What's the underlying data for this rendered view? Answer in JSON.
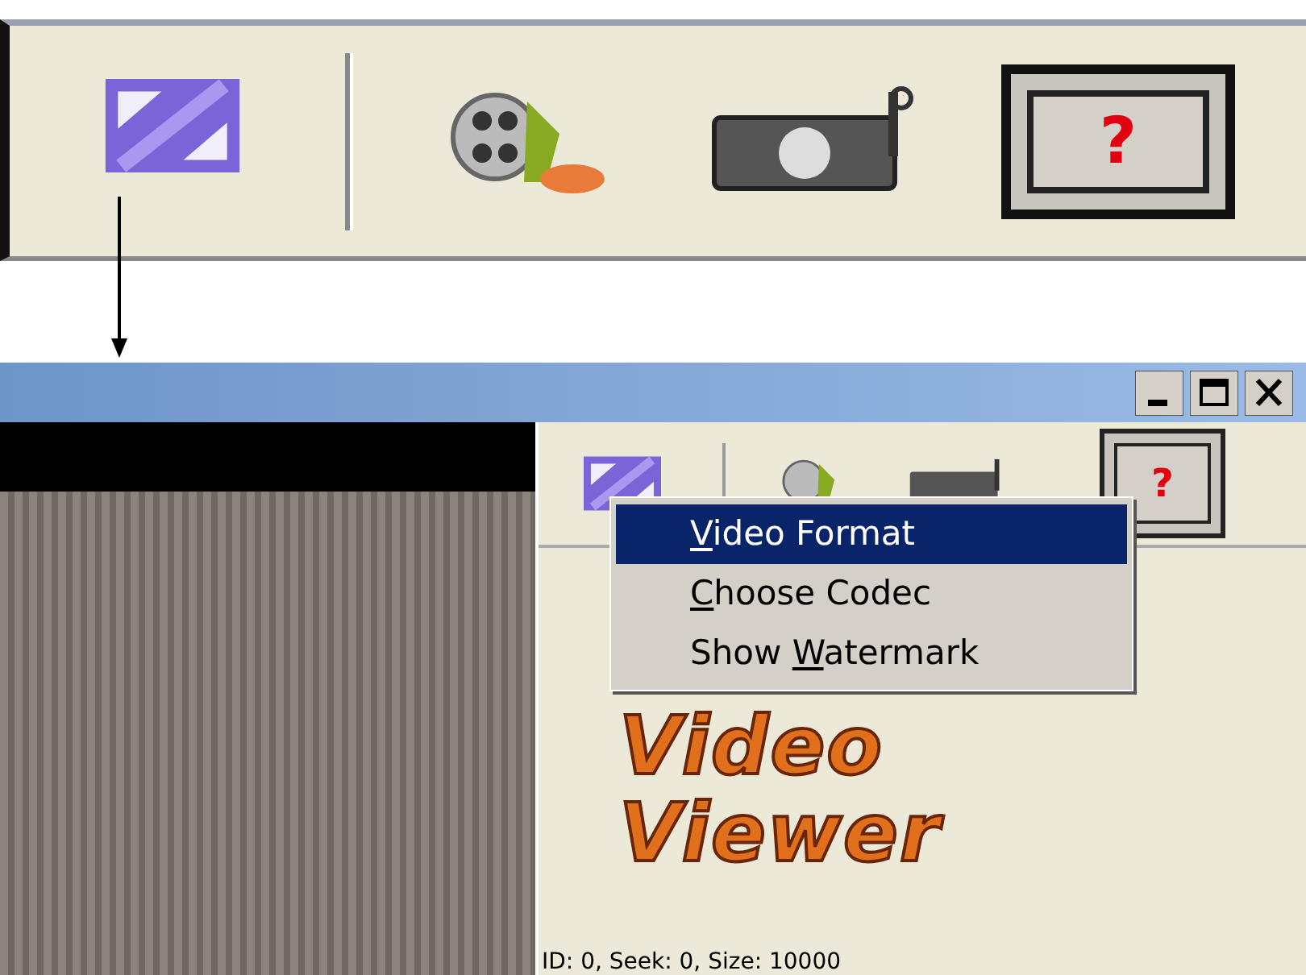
{
  "zoomed_toolbar": {
    "buttons": [
      {
        "kind": "resize"
      },
      {
        "kind": "film"
      },
      {
        "kind": "camera"
      },
      {
        "kind": "help",
        "label": "?"
      }
    ]
  },
  "window": {
    "toolbar": {
      "buttons": [
        {
          "kind": "resize"
        },
        {
          "kind": "film"
        },
        {
          "kind": "camera"
        },
        {
          "kind": "help",
          "label": "?"
        }
      ]
    },
    "menu": {
      "items": [
        {
          "accel": "V",
          "post": "ideo Format",
          "selected": true
        },
        {
          "accel": "C",
          "post": "hoose Codec",
          "selected": false
        },
        {
          "pre": "Show ",
          "accel": "W",
          "post": "atermark",
          "selected": false
        }
      ]
    },
    "logo": [
      "Video",
      "Viewer"
    ],
    "status_text": "ID: 0, Seek: 0, Size: 10000"
  }
}
